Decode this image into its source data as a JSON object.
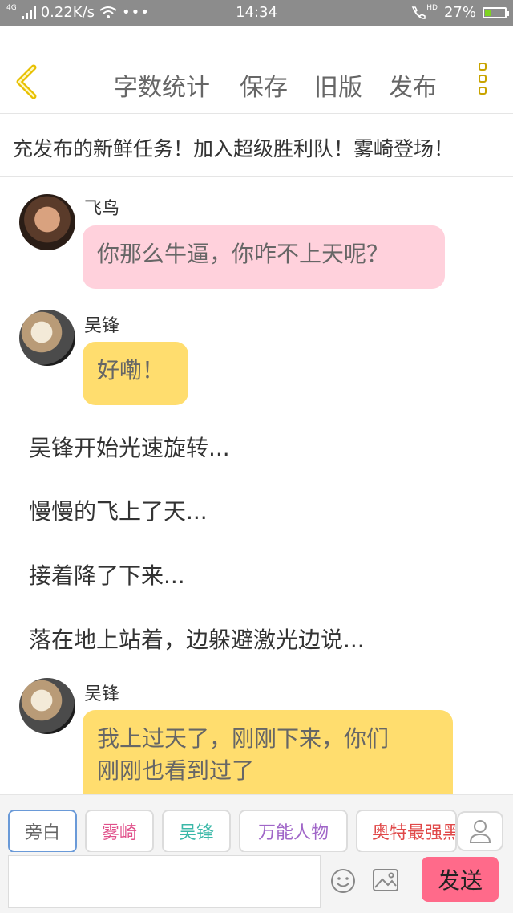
{
  "status_bar": {
    "network": "0.22K/s",
    "time": "14:34",
    "battery": "27%",
    "network_type": "4G",
    "hd_label": "HD"
  },
  "header": {
    "menu": [
      "字数统计",
      "保存",
      "旧版",
      "发布"
    ]
  },
  "notice": "充发布的新鲜任务！加入超级胜利队！雾崎登场！",
  "messages": [
    {
      "speaker": "飞鸟",
      "text": "你那么牛逼，你咋不上天呢？",
      "color": "#ffd1dc"
    },
    {
      "speaker": "吴锋",
      "text": "好嘞！",
      "color": "#ffdd6e"
    },
    {
      "narration": "吴锋开始光速旋转..."
    },
    {
      "narration": "慢慢的飞上了天..."
    },
    {
      "narration": "接着降了下来..."
    },
    {
      "narration": "落在地上站着，边躲避激光边说..."
    },
    {
      "speaker": "吴锋",
      "text": "我上过天了，刚刚下来，你们刚刚也看到过了",
      "line1": "我上过天了，刚刚下来，你们",
      "line2": "刚刚也看到过了",
      "color": "#ffdd6e"
    }
  ],
  "roles": [
    {
      "label": "旁白",
      "color": "#666666"
    },
    {
      "label": "雾崎",
      "color": "#e0508a"
    },
    {
      "label": "吴锋",
      "color": "#3bb8a8"
    },
    {
      "label": "万能人物",
      "color": "#a066c8"
    },
    {
      "label": "奥特最强黑",
      "color": "#e04848"
    }
  ],
  "send_label": "发送",
  "icons": {
    "back": "chevron-left-icon",
    "more": "more-vertical-icon",
    "person": "person-icon",
    "emoji": "emoji-icon",
    "image": "image-icon"
  },
  "accent_color": "#ffdd6e"
}
